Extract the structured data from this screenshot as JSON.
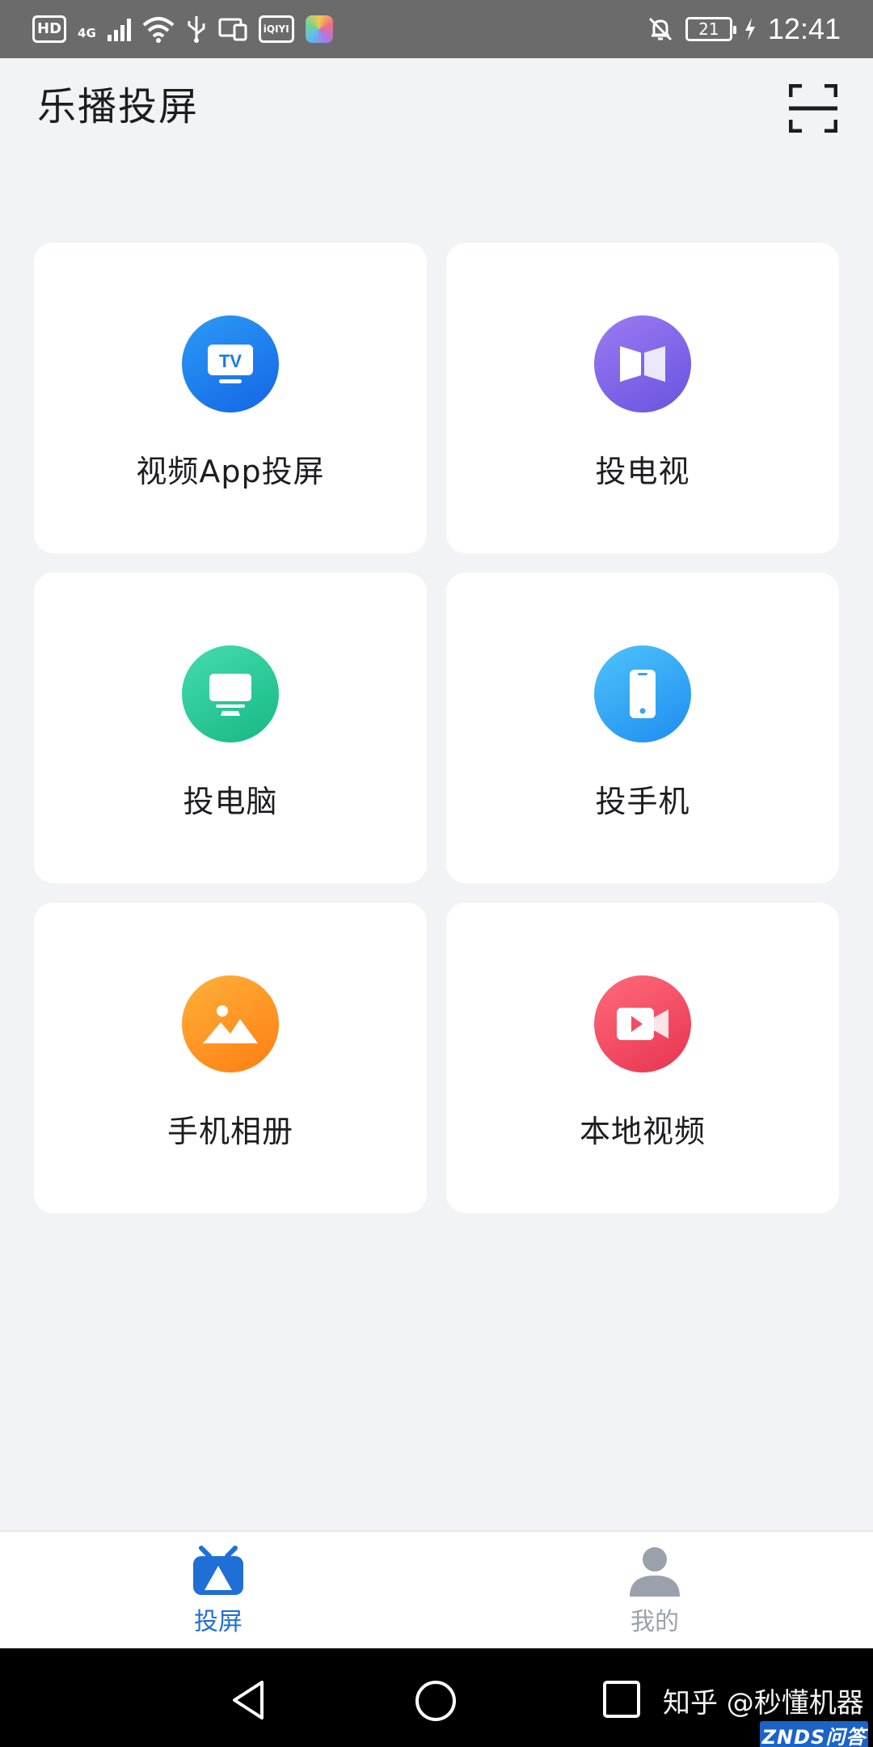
{
  "status_bar": {
    "hd": "HD",
    "network": "4G",
    "iqiyi": "iQIYI",
    "battery": "21",
    "time": "12:41"
  },
  "header": {
    "title": "乐播投屏",
    "scan_icon": "scan-icon"
  },
  "cards": [
    {
      "label": "视频App投屏",
      "icon": "tv-icon",
      "color": "#1a78ee"
    },
    {
      "label": "投电视",
      "icon": "mirror-screen-icon",
      "color": "#7f64ea"
    },
    {
      "label": "投电脑",
      "icon": "monitor-icon",
      "color": "#2acb99"
    },
    {
      "label": "投手机",
      "icon": "phone-icon",
      "color": "#34a6f5"
    },
    {
      "label": "手机相册",
      "icon": "picture-icon",
      "color": "#ff951f"
    },
    {
      "label": "本地视频",
      "icon": "video-camera-icon",
      "color": "#f14e65"
    }
  ],
  "tabbar": {
    "tabs": [
      {
        "label": "投屏",
        "icon": "tv-cast-icon",
        "active": true
      },
      {
        "label": "我的",
        "icon": "person-icon",
        "active": false
      }
    ]
  },
  "navbar": {
    "back": "back-icon",
    "home": "home-icon",
    "recents": "recents-icon"
  },
  "watermark": {
    "text": "知乎 @秒懂机器",
    "badge": "ZNDS问答"
  },
  "colors": {
    "accent": "#1f6fd6",
    "background": "#f1f3f6",
    "card": "#ffffff"
  }
}
